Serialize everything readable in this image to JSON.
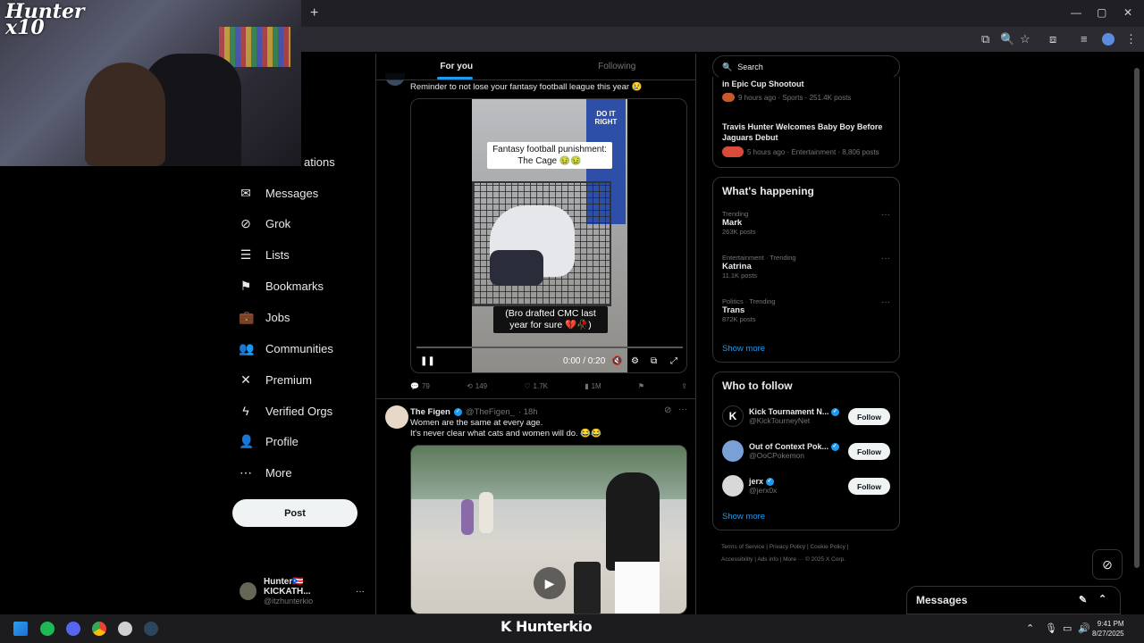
{
  "browser": {
    "new_tab": "+",
    "window_controls": [
      "—",
      "▢",
      "✕"
    ]
  },
  "webcam": {
    "logo_text": "Hunter\nx10"
  },
  "nav": {
    "items": [
      {
        "label": "Notifications",
        "icon": "bell-icon",
        "glyph": "🔔"
      },
      {
        "label": "Messages",
        "icon": "mail-icon",
        "glyph": "✉"
      },
      {
        "label": "Grok",
        "icon": "grok-icon",
        "glyph": "⊘"
      },
      {
        "label": "Lists",
        "icon": "list-icon",
        "glyph": "☰"
      },
      {
        "label": "Bookmarks",
        "icon": "bookmark-icon",
        "glyph": "⚑"
      },
      {
        "label": "Jobs",
        "icon": "briefcase-icon",
        "glyph": "💼"
      },
      {
        "label": "Communities",
        "icon": "people-icon",
        "glyph": "👥"
      },
      {
        "label": "Premium",
        "icon": "x-logo-icon",
        "glyph": "✕"
      },
      {
        "label": "Verified Orgs",
        "icon": "lightning-icon",
        "glyph": "ϟ"
      },
      {
        "label": "Profile",
        "icon": "person-icon",
        "glyph": "👤"
      },
      {
        "label": "More",
        "icon": "more-circle-icon",
        "glyph": "⋯"
      }
    ],
    "notifications_visible_fragment": "ations",
    "post_label": "Post",
    "profile_name": "Hunter🇵🇷 KICKATH...",
    "profile_handle": "@itzhunterkio",
    "profile_more": "···"
  },
  "feed": {
    "tabs": [
      {
        "label": "For you"
      },
      {
        "label": "Following"
      }
    ],
    "post1": {
      "text": "Reminder to not lose your fantasy football league this year 😢",
      "caption_top": "Fantasy football punishment:\nThe Cage 🤢🤢",
      "caption_bottom": "(Bro drafted CMC last\nyear for sure 💔🥀)",
      "shirt_text": "DO IT\nRIGHT",
      "time": "0:00 / 0:20",
      "replies": "79",
      "reposts": "149",
      "likes": "1.7K",
      "views": "1M"
    },
    "post2": {
      "author": "The Figen",
      "handle": "@TheFigen_",
      "time": "· 18h",
      "text_line1": "Women are the same at every age.",
      "text_line2": "It's never clear what cats and women will do. 😂😂"
    }
  },
  "right": {
    "search_placeholder": "Search",
    "news": [
      {
        "title": "in Epic Cup Shootout",
        "meta": "9 hours ago · Sports · 251.4K posts"
      },
      {
        "title": "Travis Hunter Welcomes Baby Boy Before Jaguars Debut",
        "meta": "5 hours ago · Entertainment · 8,806 posts"
      }
    ],
    "whats_happening": {
      "title": "What's happening",
      "trends": [
        {
          "context": "Trending",
          "name": "Mark",
          "count": "263K posts"
        },
        {
          "context": "Entertainment · Trending",
          "name": "Katrina",
          "count": "11.1K posts"
        },
        {
          "context": "Politics · Trending",
          "name": "Trans",
          "count": "872K posts"
        }
      ],
      "show_more": "Show more"
    },
    "who_to_follow": {
      "title": "Who to follow",
      "accounts": [
        {
          "name": "Kick Tournament N...",
          "handle": "@KickTourneyNet",
          "avatar_color": "#000000"
        },
        {
          "name": "Out of Context Pok...",
          "handle": "@OoCPokemon",
          "avatar_color": "#7aa0d8"
        },
        {
          "name": "jerx",
          "handle": "@jerx0x",
          "avatar_color": "#d8d8d8"
        }
      ],
      "follow_label": "Follow",
      "show_more": "Show more"
    },
    "footer_line1": "Terms of Service  |  Privacy Policy  |  Cookie Policy  |",
    "footer_line2": "Accessibility  |  Ads info  |  More ···  © 2025 X Corp."
  },
  "messages_drawer": {
    "title": "Messages"
  },
  "taskbar": {
    "watermark": "K Hunterkio",
    "time": "9:41 PM",
    "date": "8/27/2025"
  },
  "colors": {
    "accent": "#1d9bf0",
    "border": "#2f3336",
    "muted": "#71767b"
  }
}
